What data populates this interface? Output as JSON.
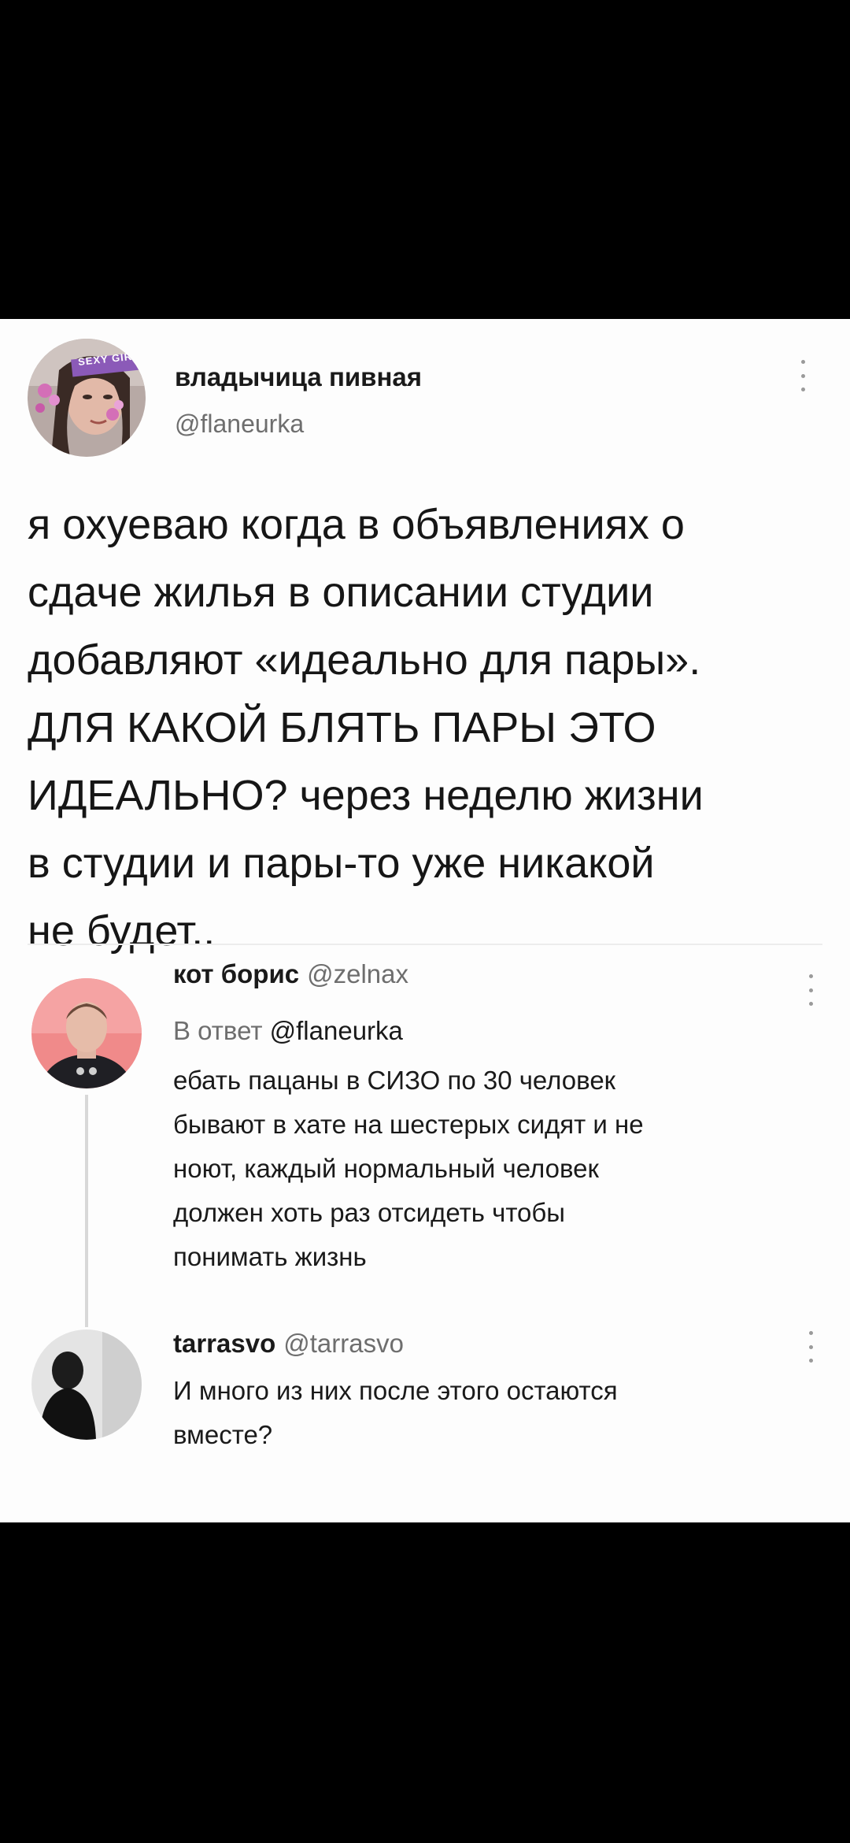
{
  "main_tweet": {
    "display_name": "владычица пивная",
    "handle": "@flaneurka",
    "avatar_badge": "SEXY GIRL",
    "text_lines": [
      "я охуеваю когда в объявлениях о",
      "сдаче жилья в описании студии",
      "добавляют «идеально для пары».",
      "ДЛЯ КАКОЙ БЛЯТЬ ПАРЫ ЭТО",
      "ИДЕАЛЬНО? через неделю жизни",
      "в студии и пары-то уже никакой",
      "не будет.."
    ]
  },
  "replies": [
    {
      "display_name": "кот борис",
      "handle": "@zelnax",
      "reply_prefix": "В ответ",
      "reply_mention": "@flaneurka",
      "text_lines": [
        "ебать пацаны в СИЗО по 30 человек",
        "бывают в хате на шестерых сидят и не",
        "ноют, каждый нормальный человек",
        "должен хоть раз отсидеть чтобы",
        "понимать жизнь"
      ]
    },
    {
      "display_name": "tarrasvo",
      "handle": "@tarrasvo",
      "text_lines": [
        "И много из них после этого остаются",
        "вместе?"
      ]
    }
  ],
  "icons": {
    "more": "more-vertical-icon"
  },
  "colors": {
    "card_bg": "#fdfdfd",
    "text": "#1a1a1a",
    "muted": "#6e6e6e"
  }
}
